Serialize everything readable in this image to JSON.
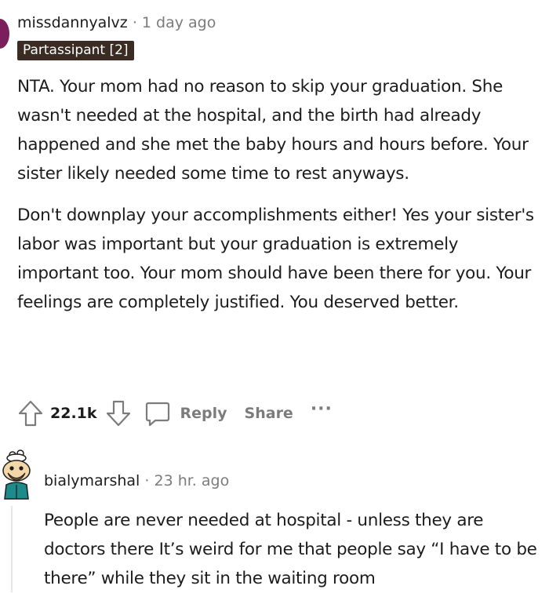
{
  "comment1": {
    "username": "missdannyalvz",
    "separator": "·",
    "time": "1 day ago",
    "flair": "Partassipant [2]",
    "paragraphs": [
      "NTA. Your mom had no reason to skip your graduation. She wasn't needed at the hospital, and the birth had already happened and she met the baby hours and hours before. Your sister likely needed some time to rest anyways.",
      "Don't downplay your accomplishments either! Yes your sister's labor was important but your graduation is extremely important too. Your mom should have been there for you. Your feelings are completely justified. You deserved better."
    ],
    "votes": "22.1k",
    "reply_label": "Reply",
    "share_label": "Share",
    "more_label": "···"
  },
  "comment2": {
    "username": "bialymarshal",
    "separator": "·",
    "time": "23 hr. ago",
    "body": "People are never needed at hospital - unless they are doctors there It’s weird for me that people say “I have to be there” while they sit in the waiting room"
  },
  "icons": {
    "upvote": "upvote-arrow-icon",
    "downvote": "downvote-arrow-icon",
    "reply": "comment-bubble-icon",
    "more": "more-dots-icon",
    "avatar": "snoo-avatar-icon"
  },
  "colors": {
    "flair_bg": "#3a2c22",
    "muted_text": "#7c7c7c",
    "avatar_edge": "#7a1f5c"
  }
}
